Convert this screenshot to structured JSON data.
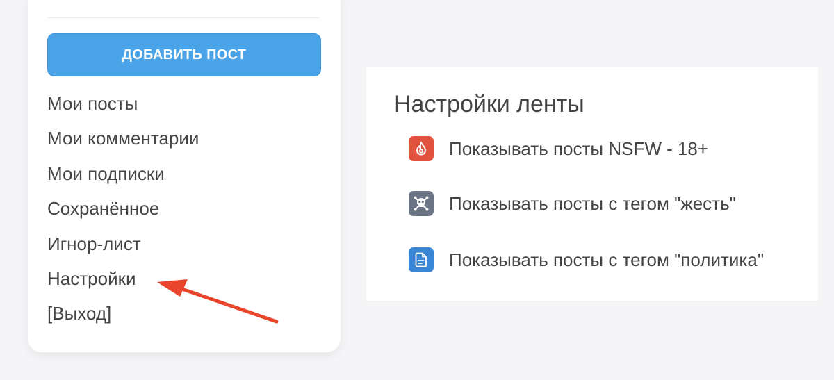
{
  "sidebar": {
    "add_post_label": "ДОБАВИТЬ ПОСТ",
    "items": [
      {
        "label": "Мои посты"
      },
      {
        "label": "Мои комментарии"
      },
      {
        "label": "Мои подписки"
      },
      {
        "label": "Сохранённое"
      },
      {
        "label": "Игнор-лист"
      },
      {
        "label": "Настройки"
      },
      {
        "label": "[Выход]"
      }
    ]
  },
  "feed_settings": {
    "title": "Настройки ленты",
    "options": [
      {
        "label": "Показывать посты NSFW - 18+",
        "icon": "flame-icon",
        "color": "#e2533f"
      },
      {
        "label": "Показывать посты с тегом \"жесть\"",
        "icon": "skull-crossbones-icon",
        "color": "#6a7484"
      },
      {
        "label": "Показывать посты с тегом \"политика\"",
        "icon": "document-icon",
        "color": "#3a86d6"
      }
    ]
  },
  "colors": {
    "button_blue": "#4aa3e6",
    "annotation_arrow": "#e8452c",
    "text": "#444446",
    "background": "#f5f5f7"
  }
}
